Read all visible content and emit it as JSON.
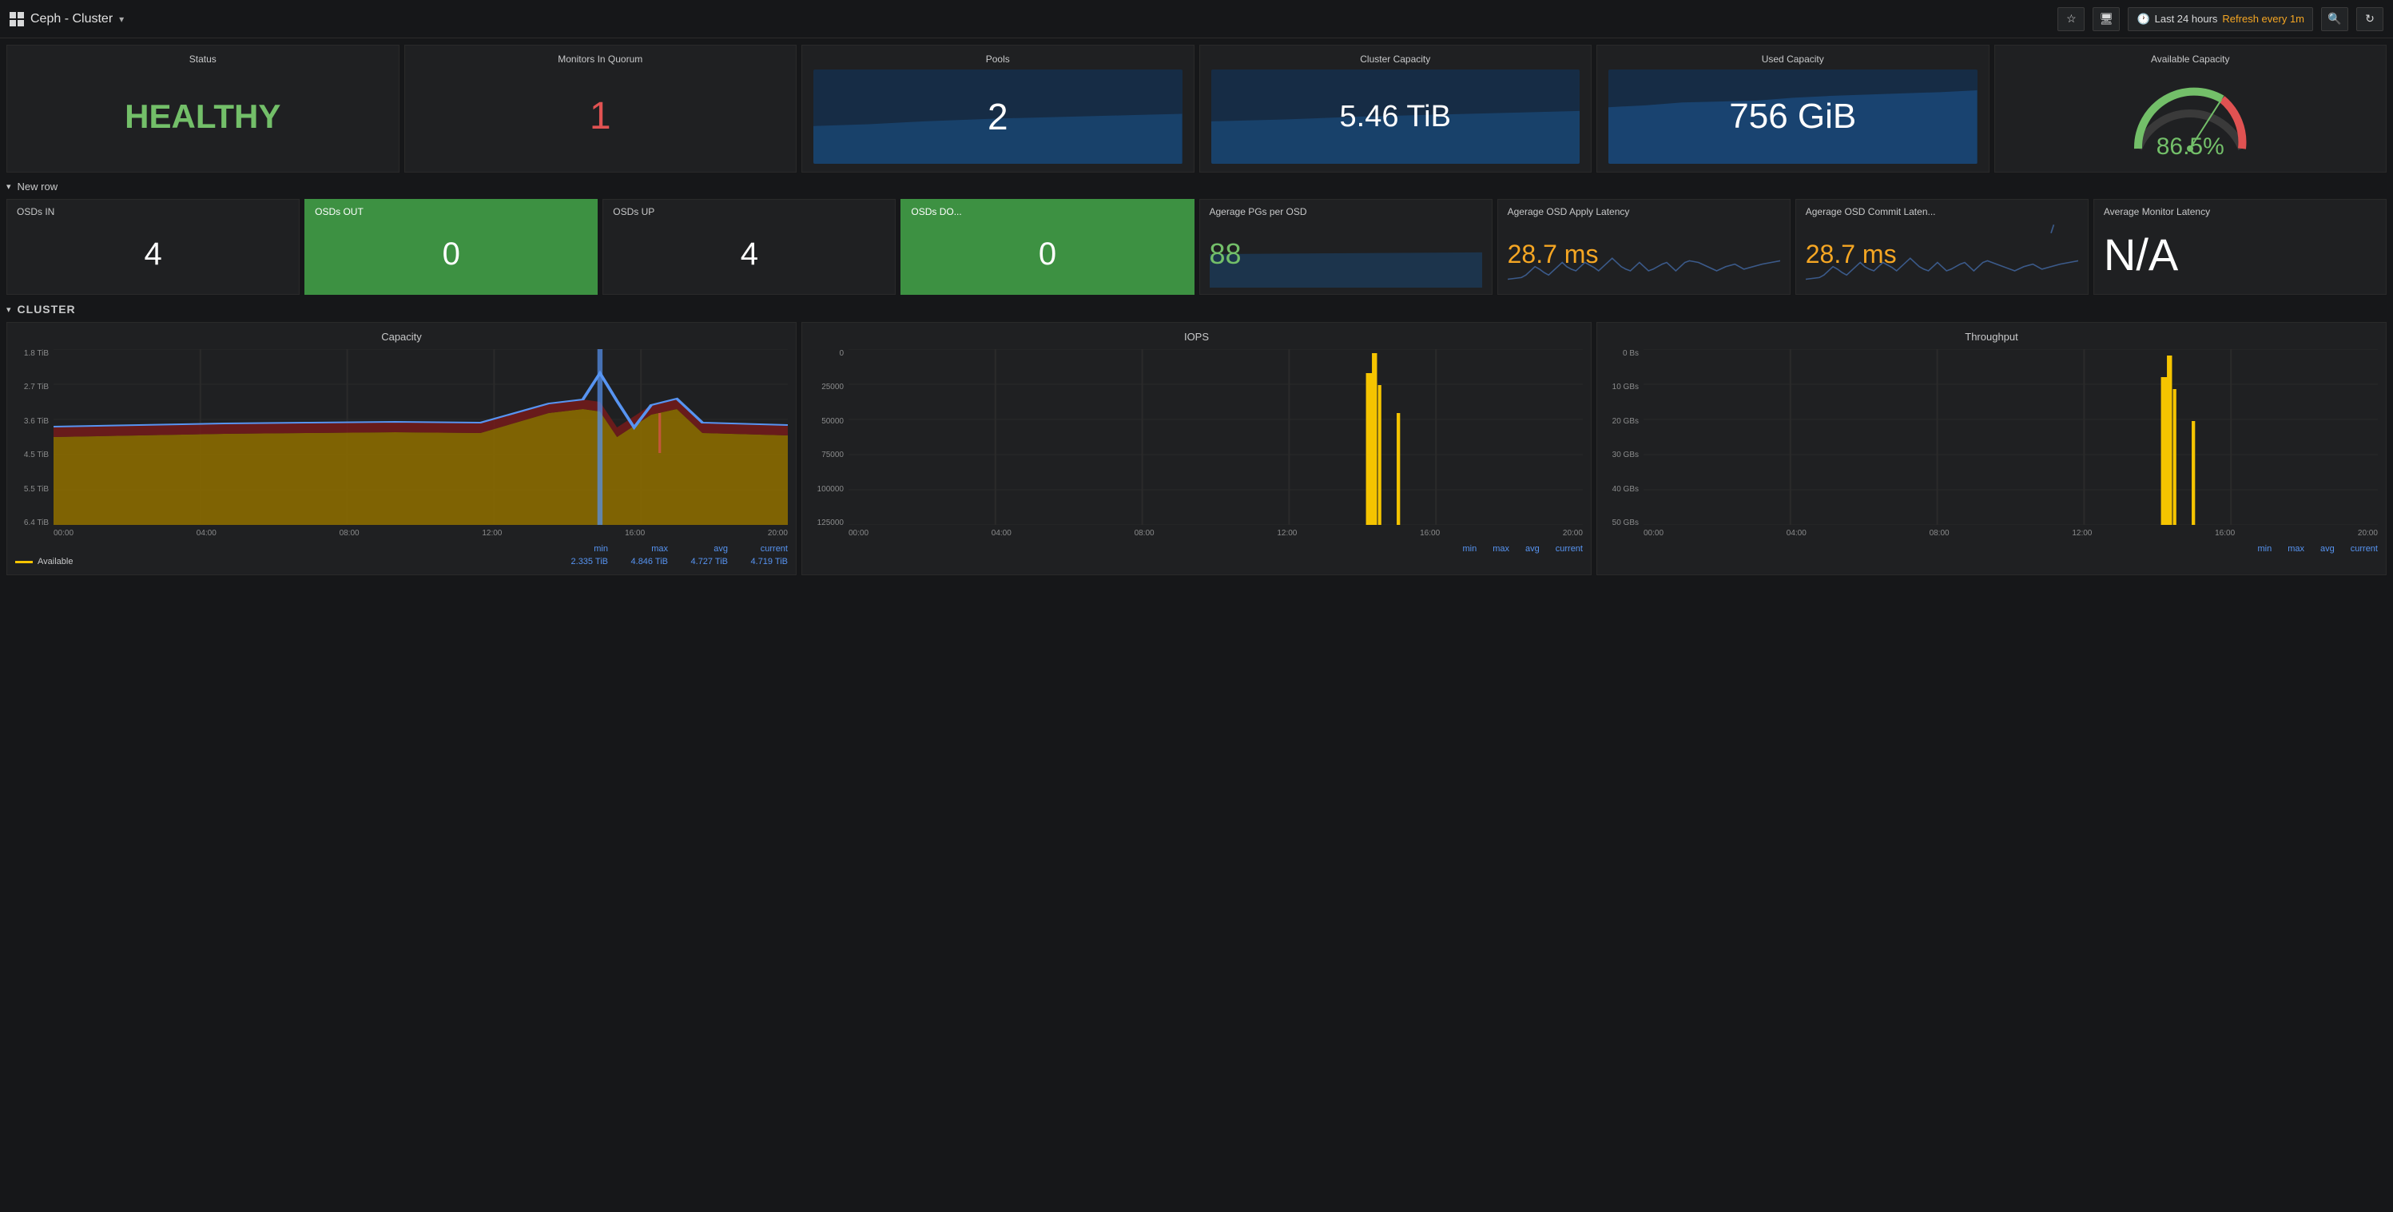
{
  "topbar": {
    "title": "Ceph - Cluster",
    "dropdown_arrow": "▾",
    "star_icon": "★",
    "monitor_icon": "⬜",
    "time_label": "Last 24 hours",
    "refresh_label": "Refresh every 1m",
    "search_icon": "🔍",
    "sync_icon": "⟳"
  },
  "stats_row": {
    "status": {
      "title": "Status",
      "value": "HEALTHY"
    },
    "monitors": {
      "title": "Monitors In Quorum",
      "value": "1"
    },
    "pools": {
      "title": "Pools",
      "value": "2"
    },
    "cluster_capacity": {
      "title": "Cluster Capacity",
      "value": "5.46 TiB"
    },
    "used_capacity": {
      "title": "Used Capacity",
      "value": "756 GiB"
    },
    "available_capacity": {
      "title": "Available Capacity",
      "value": "86.5%"
    }
  },
  "new_row": {
    "label": "New row"
  },
  "osd_row": {
    "osds_in": {
      "title": "OSDs IN",
      "value": "4"
    },
    "osds_out": {
      "title": "OSDs OUT",
      "value": "0",
      "green": true
    },
    "osds_up": {
      "title": "OSDs UP",
      "value": "4"
    },
    "osds_down": {
      "title": "OSDs DO...",
      "value": "0",
      "green": true
    },
    "pgs_per_osd": {
      "title": "Agerage PGs per OSD",
      "value": "88"
    },
    "osd_apply_latency": {
      "title": "Agerage OSD Apply Latency",
      "value": "28.7 ms"
    },
    "osd_commit_latency": {
      "title": "Agerage OSD Commit Laten...",
      "value": "28.7 ms"
    },
    "avg_monitor_latency": {
      "title": "Average Monitor Latency",
      "value": "N/A"
    }
  },
  "cluster_section": {
    "label": "CLUSTER",
    "capacity_chart": {
      "title": "Capacity",
      "y_labels": [
        "6.4 TiB",
        "5.5 TiB",
        "4.5 TiB",
        "3.6 TiB",
        "2.7 TiB",
        "1.8 TiB"
      ],
      "x_labels": [
        "00:00",
        "04:00",
        "08:00",
        "12:00",
        "16:00",
        "20:00"
      ],
      "legend_label": "Available",
      "min": "2.335 TiB",
      "max": "4.846 TiB",
      "avg": "4.727 TiB",
      "current": "4.719 TiB"
    },
    "iops_chart": {
      "title": "IOPS",
      "y_labels": [
        "125000",
        "100000",
        "75000",
        "50000",
        "25000",
        "0"
      ],
      "x_labels": [
        "00:00",
        "04:00",
        "08:00",
        "12:00",
        "16:00",
        "20:00"
      ],
      "min_label": "min",
      "max_label": "max",
      "avg_label": "avg",
      "current_label": "current"
    },
    "throughput_chart": {
      "title": "Throughput",
      "y_labels": [
        "50 GBs",
        "40 GBs",
        "30 GBs",
        "20 GBs",
        "10 GBs",
        "0 Bs"
      ],
      "x_labels": [
        "00:00",
        "04:00",
        "08:00",
        "12:00",
        "16:00",
        "20:00"
      ],
      "min_label": "min",
      "max_label": "max",
      "avg_label": "avg",
      "current_label": "current"
    }
  }
}
